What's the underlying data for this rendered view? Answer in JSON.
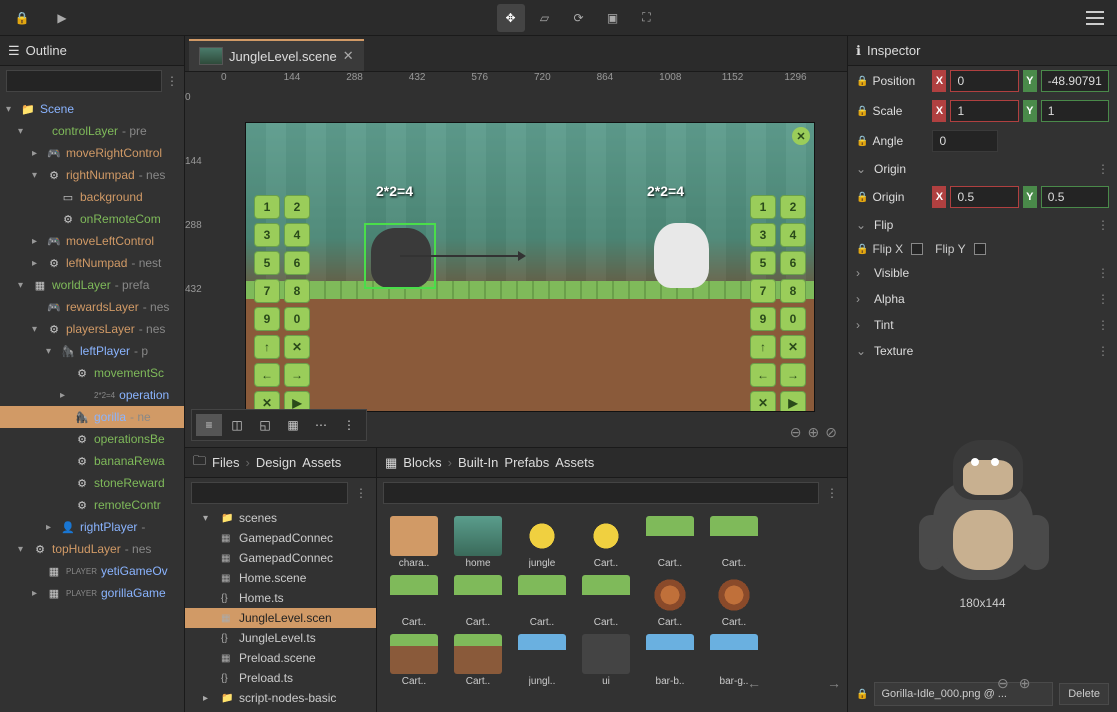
{
  "topbar": {
    "tools": [
      "move",
      "crop",
      "sync",
      "select",
      "fullscreen"
    ]
  },
  "outline": {
    "title": "Outline",
    "root": "Scene",
    "items": [
      {
        "level": 1,
        "chev": "▾",
        "name": "controlLayer",
        "suffix": " - pre",
        "cls": "green"
      },
      {
        "level": 2,
        "chev": "▸",
        "name": "moveRightControl",
        "cls": "warm",
        "ico": "🎮"
      },
      {
        "level": 2,
        "chev": "▾",
        "name": "rightNumpad",
        "suffix": " - nes",
        "cls": "warm",
        "ico": "⚙"
      },
      {
        "level": 3,
        "chev": "",
        "name": "background",
        "cls": "warm",
        "ico": "▭"
      },
      {
        "level": 3,
        "chev": "",
        "name": "onRemoteCom",
        "cls": "green",
        "ico": "⚙"
      },
      {
        "level": 2,
        "chev": "▸",
        "name": "moveLeftControl",
        "cls": "warm",
        "ico": "🎮"
      },
      {
        "level": 2,
        "chev": "▸",
        "name": "leftNumpad",
        "suffix": " - nest",
        "cls": "warm",
        "ico": "⚙"
      },
      {
        "level": 1,
        "chev": "▾",
        "name": "worldLayer",
        "suffix": " - prefa",
        "cls": "green",
        "ico": "▦"
      },
      {
        "level": 2,
        "chev": "",
        "name": "rewardsLayer",
        "suffix": " - nes",
        "cls": "warm",
        "ico": "🎮"
      },
      {
        "level": 2,
        "chev": "▾",
        "name": "playersLayer",
        "suffix": " - nes",
        "cls": "warm",
        "ico": "⚙"
      },
      {
        "level": 3,
        "chev": "▾",
        "name": "leftPlayer",
        "suffix": " - p",
        "cls": "",
        "ico": "🦍"
      },
      {
        "level": 4,
        "chev": "",
        "name": "movementSc",
        "cls": "green",
        "ico": "⚙"
      },
      {
        "level": 4,
        "chev": "▸",
        "name": "operation",
        "cls": "",
        "pre": "2*2=4"
      },
      {
        "level": 4,
        "chev": "",
        "name": "gorilla",
        "suffix": " - ne",
        "cls": "",
        "ico": "🦍",
        "sel": true
      },
      {
        "level": 4,
        "chev": "",
        "name": "operationsBe",
        "cls": "green",
        "ico": "⚙"
      },
      {
        "level": 4,
        "chev": "",
        "name": "bananaRewa",
        "cls": "green",
        "ico": "⚙"
      },
      {
        "level": 4,
        "chev": "",
        "name": "stoneReward",
        "cls": "green",
        "ico": "⚙"
      },
      {
        "level": 4,
        "chev": "",
        "name": "remoteContr",
        "cls": "green",
        "ico": "⚙"
      },
      {
        "level": 3,
        "chev": "▸",
        "name": "rightPlayer",
        "suffix": " - ",
        "cls": "",
        "ico": "👤"
      },
      {
        "level": 1,
        "chev": "▾",
        "name": "topHudLayer",
        "suffix": " - nes",
        "cls": "warm",
        "ico": "⚙"
      },
      {
        "level": 2,
        "chev": "",
        "name": "yetiGameOv",
        "cls": "",
        "ico": "▦",
        "pre": "PLAYER"
      },
      {
        "level": 2,
        "chev": "▸",
        "name": "gorillaGame",
        "cls": "",
        "ico": "▦",
        "pre": "PLAYER"
      }
    ]
  },
  "tab": {
    "label": "JungleLevel.scene"
  },
  "ruler_h": [
    "0",
    "144",
    "288",
    "432",
    "576",
    "720",
    "864",
    "1008",
    "1152",
    "1296"
  ],
  "ruler_v": [
    "0",
    "144",
    "288",
    "432"
  ],
  "expr_l": "2*2=4",
  "expr_r": "2*2=4",
  "numpad": [
    "1",
    "2",
    "3",
    "4",
    "5",
    "6",
    "7",
    "8",
    "9",
    "0",
    "↑",
    "✕",
    "←",
    "→",
    "✕",
    "▶"
  ],
  "files": {
    "crumb1": "Files",
    "crumb2": "Design",
    "crumb3": "Assets",
    "tree": [
      {
        "chev": "▾",
        "name": "scenes",
        "ico": "📁"
      },
      {
        "chev": "",
        "name": "GamepadConnec",
        "ico": "▦"
      },
      {
        "chev": "",
        "name": "GamepadConnec",
        "ico": "▦"
      },
      {
        "chev": "",
        "name": "Home.scene",
        "ico": "▦"
      },
      {
        "chev": "",
        "name": "Home.ts",
        "ico": "{}"
      },
      {
        "chev": "",
        "name": "JungleLevel.scen",
        "ico": "▦",
        "sel": true
      },
      {
        "chev": "",
        "name": "JungleLevel.ts",
        "ico": "{}"
      },
      {
        "chev": "",
        "name": "Preload.scene",
        "ico": "▦"
      },
      {
        "chev": "",
        "name": "Preload.ts",
        "ico": "{}"
      },
      {
        "chev": "▸",
        "name": "script-nodes-basic",
        "ico": "📁"
      }
    ]
  },
  "blocks": {
    "crumb1": "Blocks",
    "crumb2": "Built-In",
    "crumb3": "Prefabs",
    "crumb4": "Assets",
    "tiles": [
      {
        "label": "chara..",
        "cls": "sel"
      },
      {
        "label": "home",
        "th": "jungle-th"
      },
      {
        "label": "jungle",
        "th": "banana-th"
      },
      {
        "label": "Cart..",
        "th": "banana-th"
      },
      {
        "label": "Cart..",
        "th": "grass-th"
      },
      {
        "label": "Cart..",
        "th": "grass-th"
      },
      {
        "label": "Cart..",
        "th": "grass-th"
      },
      {
        "label": "Cart..",
        "th": "grass-th"
      },
      {
        "label": "Cart..",
        "th": "grass-th"
      },
      {
        "label": "Cart..",
        "th": "grass-th"
      },
      {
        "label": "Cart..",
        "th": "log-th"
      },
      {
        "label": "Cart..",
        "th": "log-th"
      },
      {
        "label": "Cart..",
        "th": "dirt-th"
      },
      {
        "label": "Cart..",
        "th": "dirt-th"
      },
      {
        "label": "jungl..",
        "th": "bar-th"
      },
      {
        "label": "ui",
        "th": ""
      },
      {
        "label": "bar-b..",
        "th": "bar-th"
      },
      {
        "label": "bar-g..",
        "th": "bar-th"
      }
    ]
  },
  "inspector": {
    "title": "Inspector",
    "position_lbl": "Position",
    "scale_lbl": "Scale",
    "angle_lbl": "Angle",
    "pos_x": "0",
    "pos_y": "-48.90791",
    "scale_x": "1",
    "scale_y": "1",
    "angle": "0",
    "origin_section": "Origin",
    "origin_lbl": "Origin",
    "origin_x": "0.5",
    "origin_y": "0.5",
    "flip_section": "Flip",
    "flipx": "Flip X",
    "flipy": "Flip Y",
    "visible": "Visible",
    "alpha": "Alpha",
    "tint": "Tint",
    "texture": "Texture",
    "dim": "180x144",
    "path": "Gorilla-Idle_000.png @ ...",
    "delete": "Delete"
  }
}
